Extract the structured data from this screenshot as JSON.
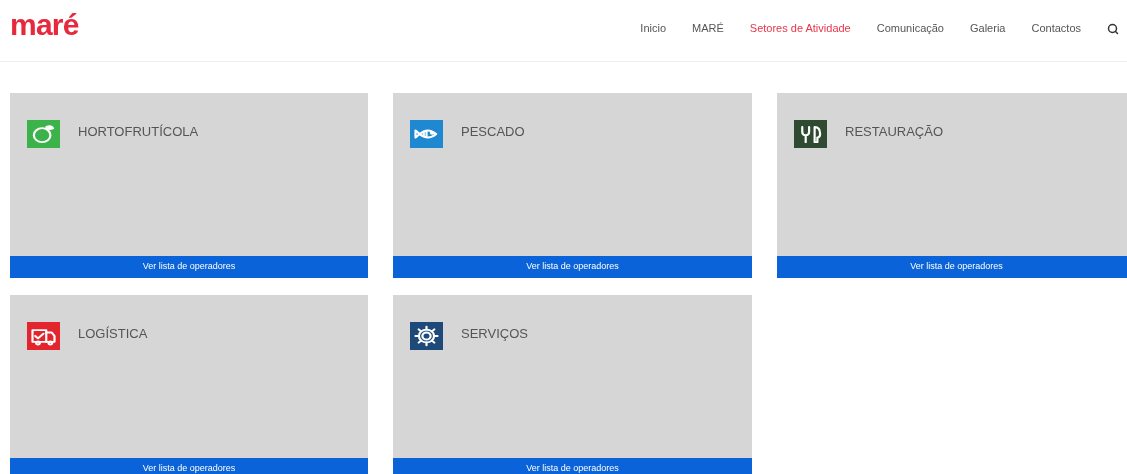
{
  "logo": {
    "text": "maré"
  },
  "nav": [
    {
      "label": "Inicio",
      "selected": false
    },
    {
      "label": "MARÉ",
      "selected": false
    },
    {
      "label": "Setores de Atividade",
      "selected": true
    },
    {
      "label": "Comunicação",
      "selected": false
    },
    {
      "label": "Galeria",
      "selected": false
    },
    {
      "label": "Contactos",
      "selected": false
    }
  ],
  "sectors": [
    {
      "title": "HORTOFRUTÍCOLA",
      "kind": "produce",
      "color": "#3cb34a",
      "button": "Ver lista de operadores"
    },
    {
      "title": "PESCADO",
      "kind": "fish",
      "color": "#1e88d0",
      "button": "Ver lista de operadores"
    },
    {
      "title": "RESTAURAÇÃO",
      "kind": "restaurant",
      "color": "#2f4a30",
      "button": "Ver lista de operadores"
    },
    {
      "title": "LOGÍSTICA",
      "kind": "logistics",
      "color": "#e3262d",
      "button": "Ver lista de operadores"
    },
    {
      "title": "SERVIÇOS",
      "kind": "services",
      "color": "#1d4a78",
      "button": "Ver lista de operadores"
    }
  ]
}
